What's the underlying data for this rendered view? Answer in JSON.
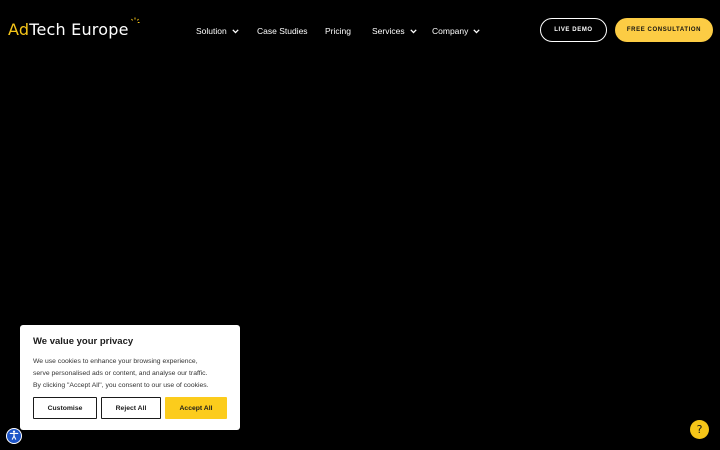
{
  "brand": {
    "logo_prefix": "Ad",
    "logo_rest": "Tech Europe",
    "accent_color": "#f5c518"
  },
  "nav": {
    "items": [
      {
        "label": "Solution",
        "has_dropdown": true
      },
      {
        "label": "Case Studies",
        "has_dropdown": false
      },
      {
        "label": "Pricing",
        "has_dropdown": false
      },
      {
        "label": "Services",
        "has_dropdown": true
      },
      {
        "label": "Company",
        "has_dropdown": true
      }
    ],
    "live_demo_label": "LIVE DEMO",
    "consultation_label": "FREE CONSULTATION"
  },
  "cookie": {
    "title": "We value your privacy",
    "line1": "We use cookies to enhance your browsing experience,",
    "line2": "serve personalised ads or content, and analyse our traffic.",
    "line3": "By clicking \"Accept All\", you consent to our use of cookies.",
    "customise_label": "Customise",
    "reject_label": "Reject All",
    "accept_label": "Accept All",
    "accept_color": "#fccc1c"
  },
  "widgets": {
    "accessibility_icon": "accessibility-icon",
    "help_icon": "question-mark-icon",
    "help_glyph": "?"
  }
}
